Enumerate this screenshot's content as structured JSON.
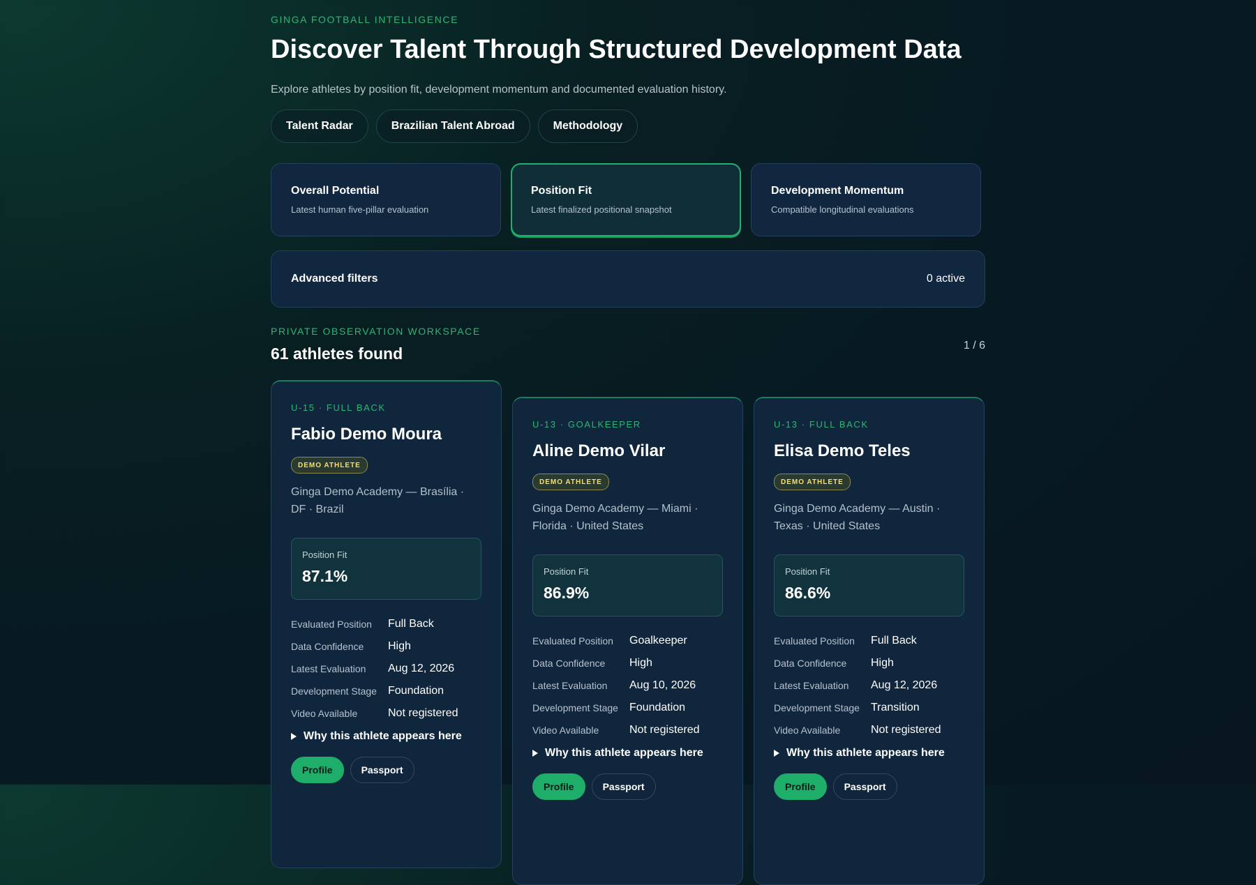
{
  "header": {
    "eyebrow": "GINGA FOOTBALL INTELLIGENCE",
    "title": "Discover Talent Through Structured Development Data",
    "subtitle": "Explore athletes by position fit, development momentum and documented evaluation history."
  },
  "nav": [
    {
      "label": "Talent Radar"
    },
    {
      "label": "Brazilian Talent Abroad"
    },
    {
      "label": "Methodology"
    }
  ],
  "modes": [
    {
      "title": "Overall Potential",
      "subtitle": "Latest human five-pillar evaluation",
      "active": false
    },
    {
      "title": "Position Fit",
      "subtitle": "Latest finalized positional snapshot",
      "active": true
    },
    {
      "title": "Development Momentum",
      "subtitle": "Compatible longitudinal evaluations",
      "active": false
    }
  ],
  "filters": {
    "label": "Advanced filters",
    "active_count": "0 active"
  },
  "results": {
    "eyebrow": "PRIVATE OBSERVATION WORKSPACE",
    "count": "61 athletes found",
    "pager": "1 / 6"
  },
  "field_labels": {
    "evaluated_position": "Evaluated Position",
    "data_confidence": "Data Confidence",
    "latest_evaluation": "Latest Evaluation",
    "development_stage": "Development Stage",
    "video_available": "Video Available"
  },
  "card_common": {
    "badge": "DEMO ATHLETE",
    "why": "Why this athlete appears here",
    "profile_label": "Profile",
    "passport_label": "Passport"
  },
  "athletes": [
    {
      "eyebrow": "U-15 · FULL BACK",
      "name": "Fabio Demo Moura",
      "org": "Ginga Demo Academy — Brasília · DF · Brazil",
      "metric_label": "Position Fit",
      "metric_value": "87.1%",
      "evaluated_position": "Full Back",
      "data_confidence": "High",
      "latest_evaluation": "Aug 12, 2026",
      "development_stage": "Foundation",
      "video_available": "Not registered"
    },
    {
      "eyebrow": "U-13 · GOALKEEPER",
      "name": "Aline Demo Vilar",
      "org": "Ginga Demo Academy — Miami · Florida · United States",
      "metric_label": "Position Fit",
      "metric_value": "86.9%",
      "evaluated_position": "Goalkeeper",
      "data_confidence": "High",
      "latest_evaluation": "Aug 10, 2026",
      "development_stage": "Foundation",
      "video_available": "Not registered"
    },
    {
      "eyebrow": "U-13 · FULL BACK",
      "name": "Elisa Demo Teles",
      "org": "Ginga Demo Academy — Austin · Texas · United States",
      "metric_label": "Position Fit",
      "metric_value": "86.6%",
      "evaluated_position": "Full Back",
      "data_confidence": "High",
      "latest_evaluation": "Aug 12, 2026",
      "development_stage": "Transition",
      "video_available": "Not registered"
    }
  ]
}
